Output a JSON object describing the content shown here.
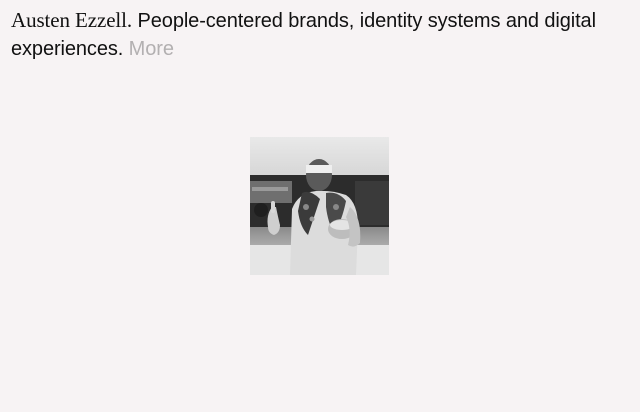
{
  "header": {
    "name": "Austen Ezzell.",
    "tagline": "People-centered brands, identity systems and digital experiences.",
    "more_link": "More"
  },
  "photo": {
    "description_icon": "portrait-photo",
    "tone": "black-and-white"
  },
  "colors": {
    "background": "#f7f3f4",
    "text": "#111111",
    "muted_link": "#b3b0b1"
  }
}
